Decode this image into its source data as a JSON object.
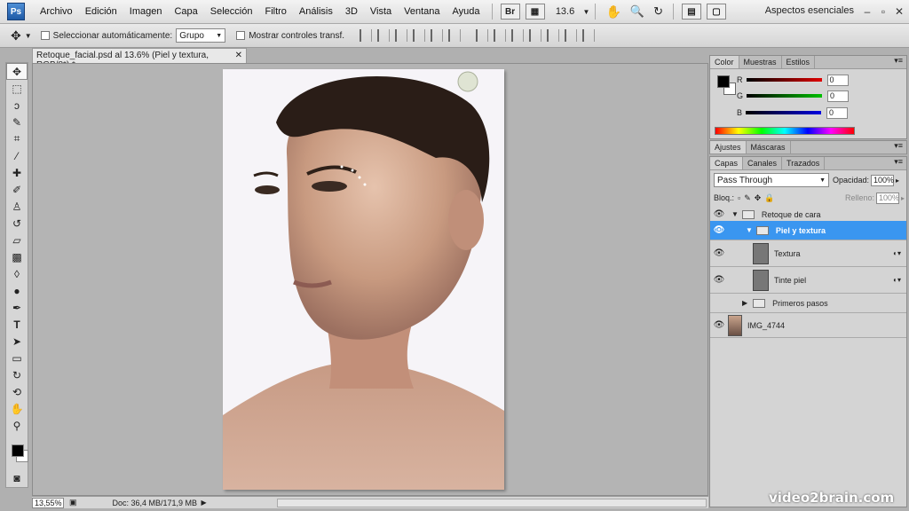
{
  "app": {
    "logo": "Ps"
  },
  "menu": [
    "Archivo",
    "Edición",
    "Imagen",
    "Capa",
    "Selección",
    "Filtro",
    "Análisis",
    "3D",
    "Vista",
    "Ventana",
    "Ayuda"
  ],
  "menubar": {
    "br_label": "Br",
    "zoom": "13.6",
    "workspace": "Aspectos esenciales"
  },
  "options": {
    "auto_select_label": "Seleccionar automáticamente:",
    "auto_select_value": "Grupo",
    "transform_label": "Mostrar controles transf."
  },
  "document": {
    "tab_title": "Retoque_facial.psd al 13.6% (Piel y textura, RGB/8*) *",
    "status_zoom": "13,55%",
    "status_doc": "Doc: 36,4 MB/171,9 MB"
  },
  "color_panel": {
    "tabs": [
      "Color",
      "Muestras",
      "Estilos"
    ],
    "channels": [
      {
        "label": "R",
        "value": "0",
        "color": "#d00000"
      },
      {
        "label": "G",
        "value": "0",
        "color": "#00a000"
      },
      {
        "label": "B",
        "value": "0",
        "color": "#0000c8"
      }
    ]
  },
  "adjust_panel": {
    "tabs": [
      "Ajustes",
      "Máscaras"
    ]
  },
  "layers_panel": {
    "tabs": [
      "Capas",
      "Canales",
      "Trazados"
    ],
    "blend_mode": "Pass Through",
    "opacity_label": "Opacidad:",
    "opacity_value": "100%",
    "lock_label": "Bloq.:",
    "fill_label": "Relleno:",
    "fill_value": "100%",
    "layers": [
      {
        "name": "Retoque de cara",
        "kind": "group"
      },
      {
        "name": "Piel y textura",
        "kind": "group",
        "selected": true
      },
      {
        "name": "Textura",
        "kind": "layer"
      },
      {
        "name": "Tinte piel",
        "kind": "layer"
      },
      {
        "name": "Primeros pasos",
        "kind": "group"
      },
      {
        "name": "IMG_4744",
        "kind": "photo"
      }
    ]
  },
  "watermark": "video2brain.com",
  "colors": {
    "selection": "#3a96f0",
    "foreground": "#000000",
    "background": "#ffffff"
  }
}
